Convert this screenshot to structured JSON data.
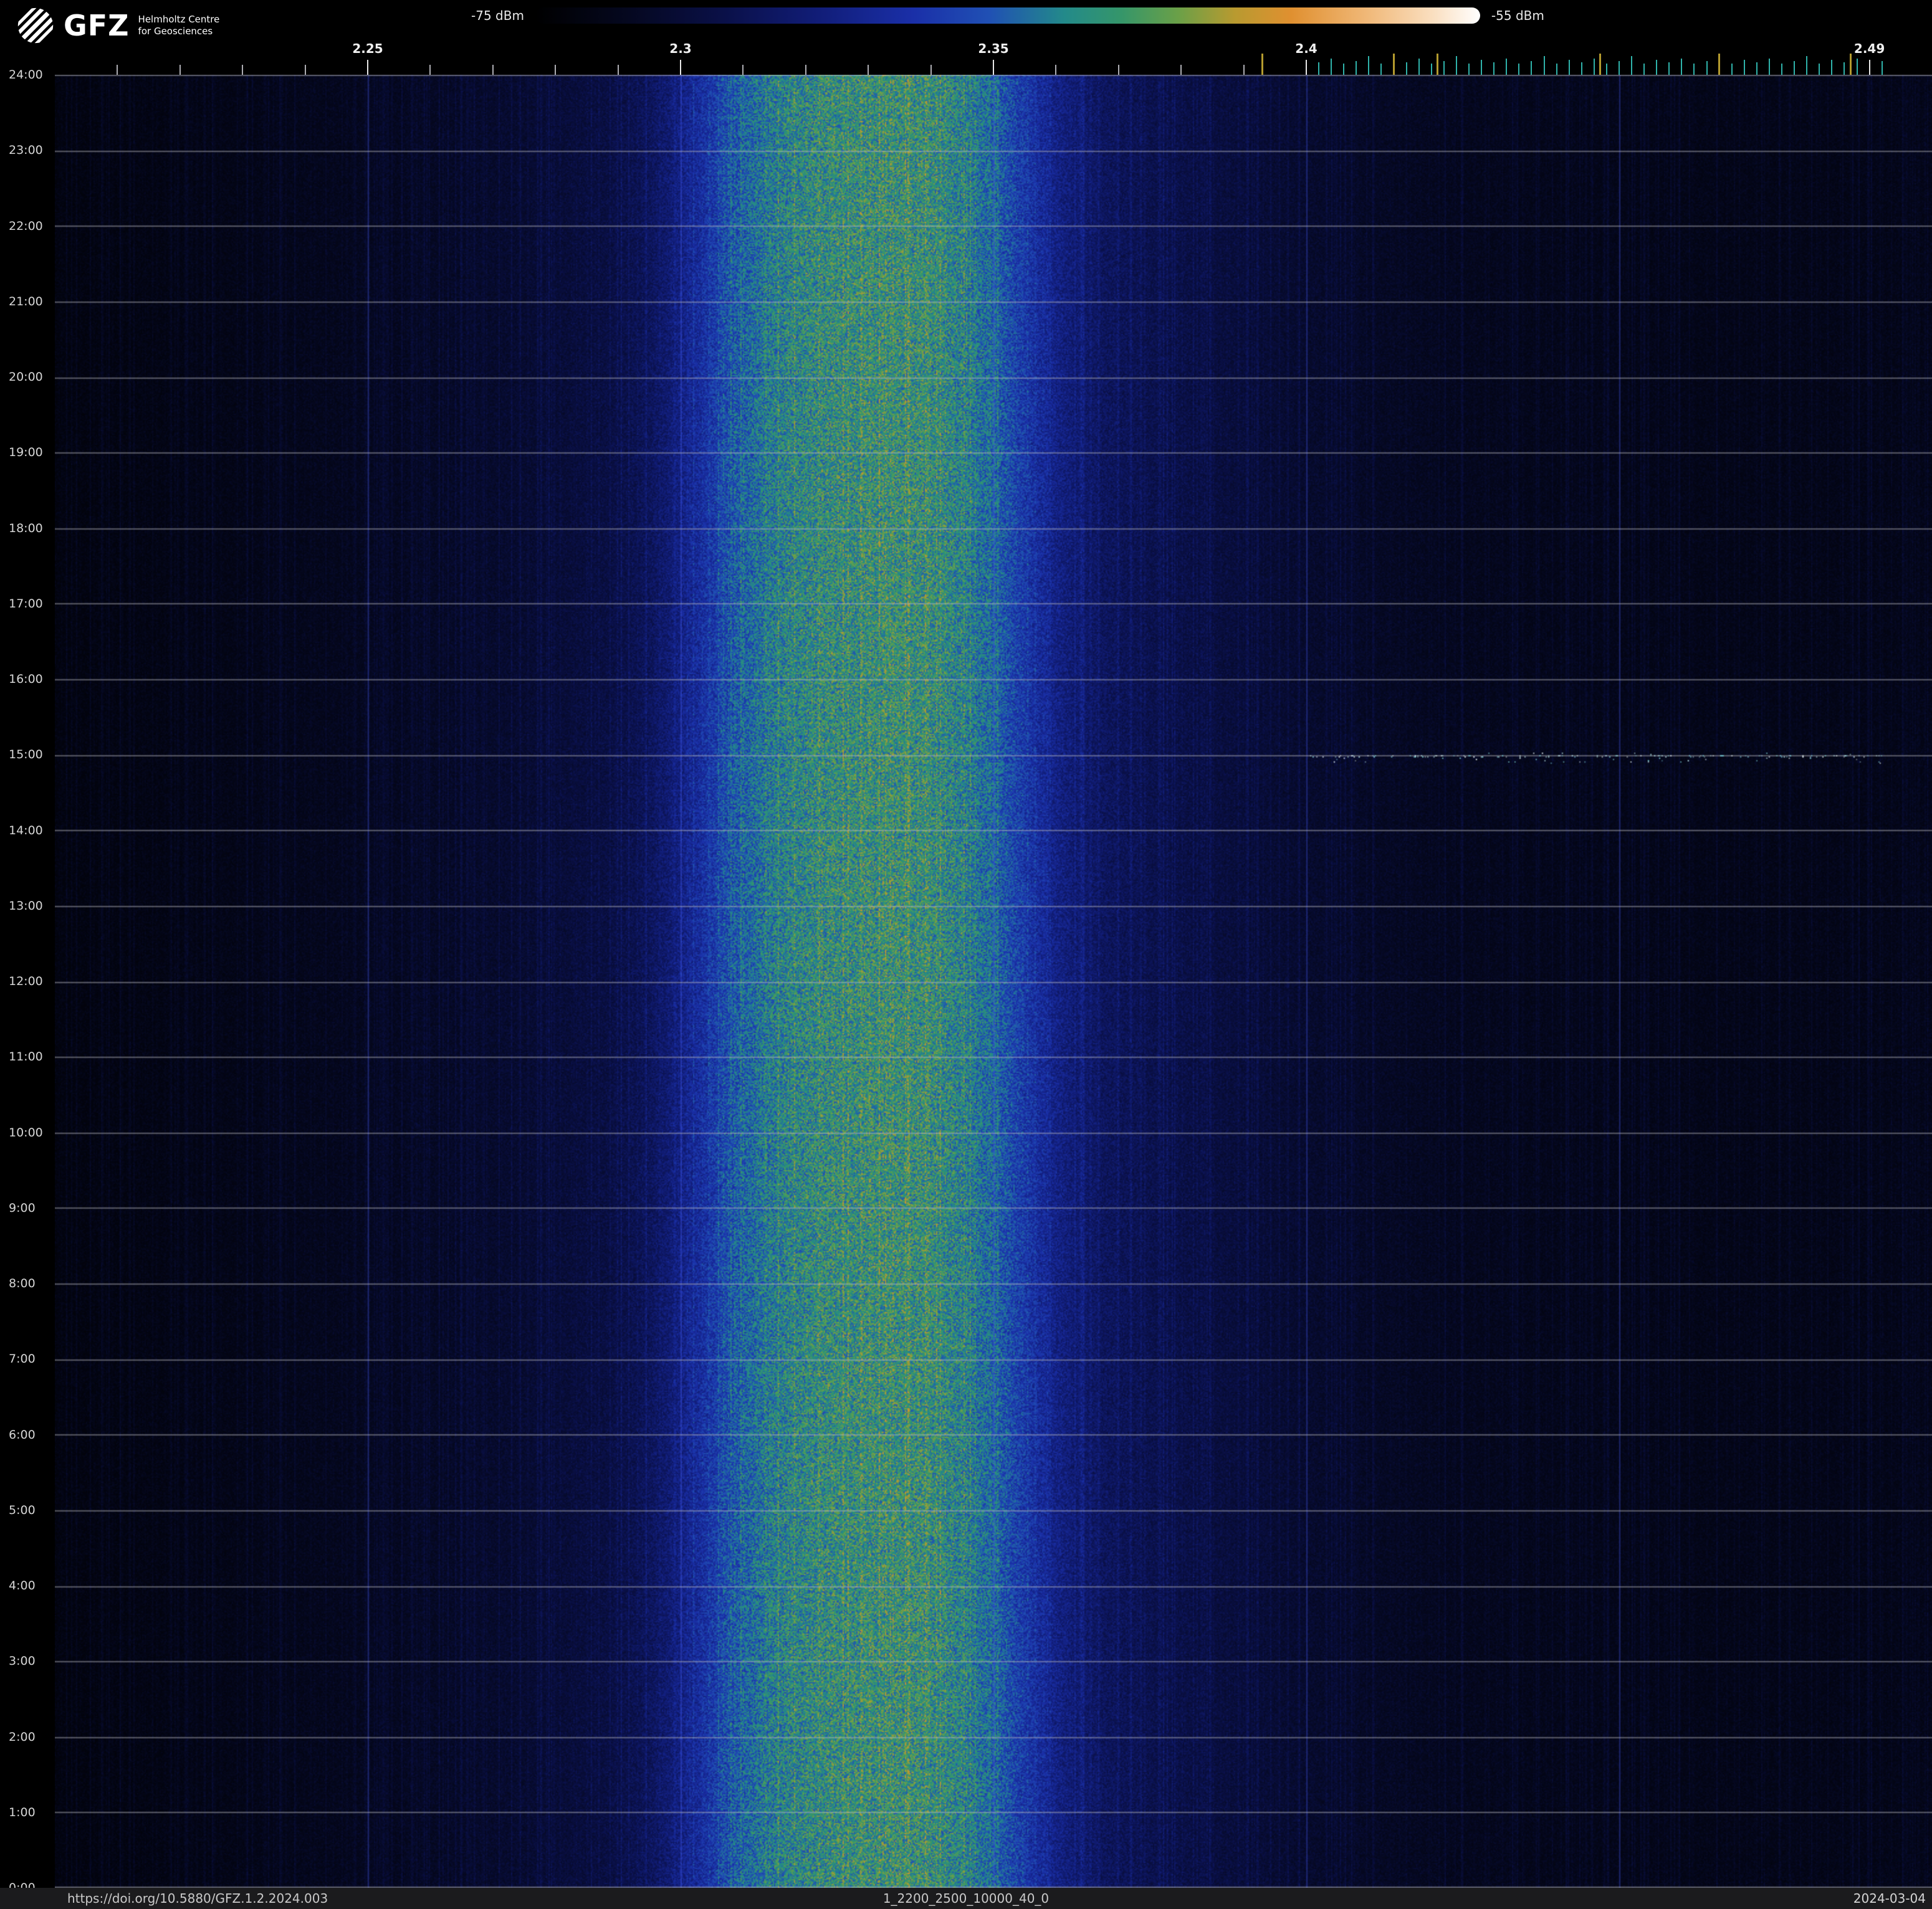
{
  "header": {
    "logo": {
      "acronym": "GFZ",
      "line1": "Helmholtz Centre",
      "line2": "for Geosciences"
    },
    "colorbar": {
      "min_label": "-75 dBm",
      "max_label": "-55 dBm",
      "stops": [
        {
          "pos": 0.0,
          "color": "#000000"
        },
        {
          "pos": 0.1,
          "color": "#050820"
        },
        {
          "pos": 0.2,
          "color": "#0a1048"
        },
        {
          "pos": 0.3,
          "color": "#111d78"
        },
        {
          "pos": 0.4,
          "color": "#1a2fa8"
        },
        {
          "pos": 0.48,
          "color": "#2050b4"
        },
        {
          "pos": 0.56,
          "color": "#238a8a"
        },
        {
          "pos": 0.62,
          "color": "#35966a"
        },
        {
          "pos": 0.68,
          "color": "#6aa048"
        },
        {
          "pos": 0.74,
          "color": "#b89a30"
        },
        {
          "pos": 0.8,
          "color": "#e09030"
        },
        {
          "pos": 0.88,
          "color": "#f0b878"
        },
        {
          "pos": 0.95,
          "color": "#fadfc0"
        },
        {
          "pos": 1.0,
          "color": "#ffffff"
        }
      ]
    }
  },
  "footer": {
    "doi": "https://doi.org/10.5880/GFZ.1.2.2024.003",
    "filename": "1_2200_2500_10000_40_0",
    "date": "2024-03-04"
  },
  "chart_data": {
    "type": "heatmap",
    "x_range": [
      2.2,
      2.5
    ],
    "y_range_hours": [
      0,
      24
    ],
    "value_range": [
      -75,
      -55
    ],
    "x_major_ticks": [
      {
        "value": 2.25,
        "label": "2.25"
      },
      {
        "value": 2.3,
        "label": "2.3"
      },
      {
        "value": 2.35,
        "label": "2.35"
      },
      {
        "value": 2.4,
        "label": "2.4"
      },
      {
        "value": 2.49,
        "label": "2.49"
      }
    ],
    "y_ticks": [
      "24:00",
      "23:00",
      "22:00",
      "21:00",
      "20:00",
      "19:00",
      "18:00",
      "17:00",
      "16:00",
      "15:00",
      "14:00",
      "13:00",
      "12:00",
      "11:00",
      "10:00",
      "9:00",
      "8:00",
      "7:00",
      "6:00",
      "5:00",
      "4:00",
      "3:00",
      "2:00",
      "1:00",
      "0:00"
    ],
    "signal_band": {
      "center": 2.329,
      "core_width": 0.028,
      "core_amp": 0.3,
      "glow_center": 2.336,
      "glow_width": 0.056,
      "glow_amp": 0.22
    },
    "background": {
      "base": 0.035,
      "ramp": 0.025,
      "ramp_width": 0.04
    },
    "grid": {
      "vertical_at": [
        2.25,
        2.3,
        2.35,
        2.4,
        2.45
      ],
      "v_color": "rgba(64,84,228,0.42)",
      "horizontal_every_hours": 1,
      "h_color": "rgba(186,186,192,0.5)"
    },
    "minor_ticks": {
      "start": 2.21,
      "end": 2.4,
      "step": 0.01,
      "color": "rgba(205,205,212,0.85)"
    },
    "dense_ticks": {
      "start": 2.402,
      "end": 2.492,
      "step": 0.002,
      "color": "#2fb3ab"
    },
    "accent_ticks": [
      {
        "value": 2.393,
        "color": "#b49b2e"
      },
      {
        "value": 2.414,
        "color": "#b49b2e"
      },
      {
        "value": 2.421,
        "color": "#b49b2e"
      },
      {
        "value": 2.447,
        "color": "#b49b2e"
      },
      {
        "value": 2.466,
        "color": "#b49b2e"
      },
      {
        "value": 2.487,
        "color": "#b49b2e"
      }
    ],
    "speckle_line": {
      "time_hour": 15,
      "f_start": 2.4,
      "f_end": 2.492,
      "count": 170,
      "colors": [
        "#bfeef2",
        "#7fd8de",
        "#e8f6f8"
      ]
    },
    "noise": {
      "mult_min": 0.8,
      "mult_span": 0.4,
      "add_amp": 0.05,
      "streak_amp": 0.06,
      "seed": 987654321
    }
  }
}
